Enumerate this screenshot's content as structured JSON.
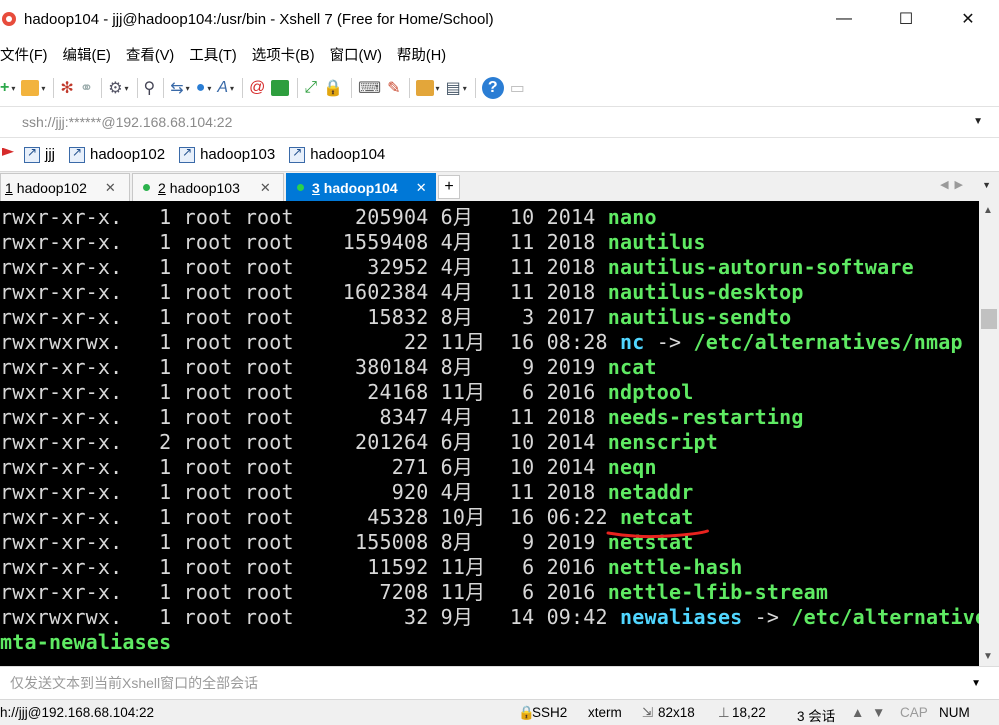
{
  "window": {
    "title": "hadoop104 - jjj@hadoop104:/usr/bin - Xshell 7 (Free for Home/School)",
    "minimize": "—",
    "maximize": "☐",
    "close": "✕"
  },
  "menu": [
    "文件(F)",
    "编辑(E)",
    "查看(V)",
    "工具(T)",
    "选项卡(B)",
    "窗口(W)",
    "帮助(H)"
  ],
  "address": {
    "text": "ssh://jjj:******@192.168.68.104:22"
  },
  "links": [
    "jjj",
    "hadoop102",
    "hadoop103",
    "hadoop104"
  ],
  "tabs": [
    {
      "num": "1",
      "label": "hadoop102",
      "active": false,
      "dot": false
    },
    {
      "num": "2",
      "label": "hadoop103",
      "active": false,
      "dot": true
    },
    {
      "num": "3",
      "label": "hadoop104",
      "active": true,
      "dot": true
    }
  ],
  "tab_close": "✕",
  "tab_add": "+",
  "terminal": {
    "lines": [
      {
        "prefix": "rwxr-xr-x.   1 root root     205904 6月   10 2014 ",
        "name": "nano",
        "suffix": "",
        "style": "green"
      },
      {
        "prefix": "rwxr-xr-x.   1 root root    1559408 4月   11 2018 ",
        "name": "nautilus",
        "suffix": "",
        "style": "green"
      },
      {
        "prefix": "rwxr-xr-x.   1 root root      32952 4月   11 2018 ",
        "name": "nautilus-autorun-software",
        "suffix": "",
        "style": "green"
      },
      {
        "prefix": "rwxr-xr-x.   1 root root    1602384 4月   11 2018 ",
        "name": "nautilus-desktop",
        "suffix": "",
        "style": "green"
      },
      {
        "prefix": "rwxr-xr-x.   1 root root      15832 8月    3 2017 ",
        "name": "nautilus-sendto",
        "suffix": "",
        "style": "green"
      },
      {
        "prefix": "rwxrwxrwx.   1 root root         22 11月  16 08:28 ",
        "name": "nc",
        "suffix": " -> ",
        "target": "/etc/alternatives/nmap",
        "style": "cyan"
      },
      {
        "prefix": "rwxr-xr-x.   1 root root     380184 8月    9 2019 ",
        "name": "ncat",
        "suffix": "",
        "style": "green"
      },
      {
        "prefix": "rwxr-xr-x.   1 root root      24168 11月   6 2016 ",
        "name": "ndptool",
        "suffix": "",
        "style": "green"
      },
      {
        "prefix": "rwxr-xr-x.   1 root root       8347 4月   11 2018 ",
        "name": "needs-restarting",
        "suffix": "",
        "style": "green"
      },
      {
        "prefix": "rwxr-xr-x.   2 root root     201264 6月   10 2014 ",
        "name": "nenscript",
        "suffix": "",
        "style": "green"
      },
      {
        "prefix": "rwxr-xr-x.   1 root root        271 6月   10 2014 ",
        "name": "neqn",
        "suffix": "",
        "style": "green"
      },
      {
        "prefix": "rwxr-xr-x.   1 root root        920 4月   11 2018 ",
        "name": "netaddr",
        "suffix": "",
        "style": "green"
      },
      {
        "prefix": "rwxr-xr-x.   1 root root      45328 10月  16 06:22 ",
        "name": "netcat",
        "suffix": "",
        "style": "green"
      },
      {
        "prefix": "rwxr-xr-x.   1 root root     155008 8月    9 2019 ",
        "name": "netstat",
        "suffix": "",
        "style": "green"
      },
      {
        "prefix": "rwxr-xr-x.   1 root root      11592 11月   6 2016 ",
        "name": "nettle-hash",
        "suffix": "",
        "style": "green"
      },
      {
        "prefix": "rwxr-xr-x.   1 root root       7208 11月   6 2016 ",
        "name": "nettle-lfib-stream",
        "suffix": "",
        "style": "green"
      },
      {
        "prefix": "rwxrwxrwx.   1 root root         32 9月   14 09:42 ",
        "name": "newaliases",
        "suffix": " -> ",
        "target": "/etc/alternatives",
        "style": "cyan"
      },
      {
        "prefix": "",
        "name": "mta-newaliases",
        "suffix": "",
        "style": "green"
      }
    ],
    "annotation_color": "#e8231f"
  },
  "send": {
    "placeholder": "仅发送文本到当前Xshell窗口的全部会话"
  },
  "status": {
    "connection": "h://jjj@192.168.68.104:22",
    "protocol": "SSH2",
    "term": "xterm",
    "size": "82x18",
    "cursor": "18,22",
    "sessions": "3 会话",
    "cap": "CAP",
    "num": "NUM"
  },
  "colors": {
    "accent": "#0078d7",
    "term_bg": "#000000",
    "green": "#5fea63",
    "cyan": "#51d6ff"
  }
}
